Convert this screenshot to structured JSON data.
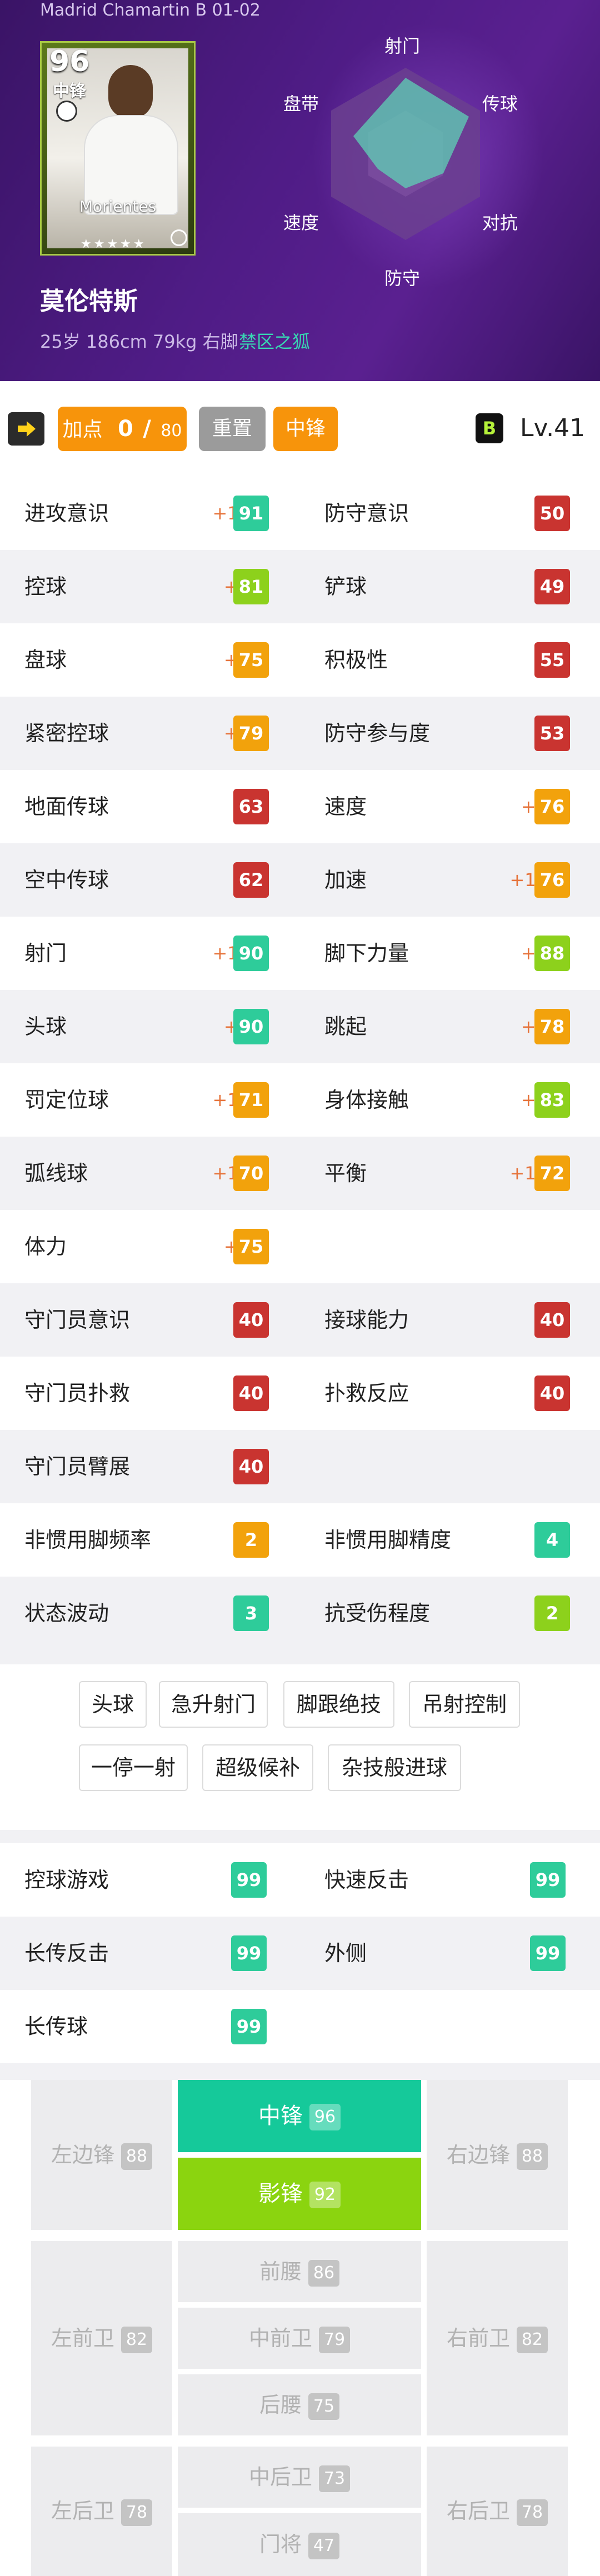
{
  "header": {
    "subtitle": "Madrid Chamartin B 01-02",
    "card": {
      "rating": "96",
      "position": "中锋",
      "name": "Morientes",
      "stars": "★★★★★"
    },
    "player_name": "莫伦特斯",
    "player_info": "25岁 186cm 79kg 右脚",
    "player_tag": "禁区之狐",
    "radar": {
      "labels": {
        "top": "射门",
        "top_left": "盘带",
        "top_right": "传球",
        "bottom_left": "速度",
        "bottom_right": "对抗",
        "bottom": "防守"
      },
      "colors": {
        "hex": "#6b3f8f",
        "hex_inner": "#7c4ea0",
        "fill": "#5fd1b5"
      }
    }
  },
  "toolbar": {
    "arrow_icon": "right-arrow-icon",
    "points_label": "加点",
    "points_value": "0",
    "points_sep": "/",
    "points_max": "80",
    "reset_label": "重置",
    "position_label": "中锋",
    "level_badge": "B",
    "level_text": "Lv.41"
  },
  "colors": {
    "green": "#2ecc9a",
    "lime": "#8dd11c",
    "orange": "#f2a20c",
    "red": "#c93430",
    "bonus": "#e6733a",
    "accent": "#f7940b"
  },
  "stats": [
    {
      "left": {
        "label": "进攻意识",
        "bonus": "+12",
        "value": "91",
        "tier": "green"
      },
      "right": {
        "label": "防守意识",
        "bonus": "",
        "value": "50",
        "tier": "red"
      }
    },
    {
      "left": {
        "label": "控球",
        "bonus": "+8",
        "value": "81",
        "tier": "lime"
      },
      "right": {
        "label": "铲球",
        "bonus": "",
        "value": "49",
        "tier": "red"
      }
    },
    {
      "left": {
        "label": "盘球",
        "bonus": "+8",
        "value": "75",
        "tier": "orange"
      },
      "right": {
        "label": "积极性",
        "bonus": "",
        "value": "55",
        "tier": "red"
      }
    },
    {
      "left": {
        "label": "紧密控球",
        "bonus": "+8",
        "value": "79",
        "tier": "orange"
      },
      "right": {
        "label": "防守参与度",
        "bonus": "",
        "value": "53",
        "tier": "red"
      }
    },
    {
      "left": {
        "label": "地面传球",
        "bonus": "",
        "value": "63",
        "tier": "red"
      },
      "right": {
        "label": "速度",
        "bonus": "+8",
        "value": "76",
        "tier": "orange"
      }
    },
    {
      "left": {
        "label": "空中传球",
        "bonus": "",
        "value": "62",
        "tier": "red"
      },
      "right": {
        "label": "加速",
        "bonus": "+12",
        "value": "76",
        "tier": "orange"
      }
    },
    {
      "left": {
        "label": "射门",
        "bonus": "+12",
        "value": "90",
        "tier": "green"
      },
      "right": {
        "label": "脚下力量",
        "bonus": "+8",
        "value": "88",
        "tier": "lime"
      }
    },
    {
      "left": {
        "label": "头球",
        "bonus": "+6",
        "value": "90",
        "tier": "green"
      },
      "right": {
        "label": "跳起",
        "bonus": "+6",
        "value": "78",
        "tier": "orange"
      }
    },
    {
      "left": {
        "label": "罚定位球",
        "bonus": "+12",
        "value": "71",
        "tier": "orange"
      },
      "right": {
        "label": "身体接触",
        "bonus": "+6",
        "value": "83",
        "tier": "lime"
      }
    },
    {
      "left": {
        "label": "弧线球",
        "bonus": "+12",
        "value": "70",
        "tier": "orange"
      },
      "right": {
        "label": "平衡",
        "bonus": "+12",
        "value": "72",
        "tier": "orange"
      }
    },
    {
      "left": {
        "label": "体力",
        "bonus": "+8",
        "value": "75",
        "tier": "orange"
      },
      "right": null
    },
    {
      "left": {
        "label": "守门员意识",
        "bonus": "",
        "value": "40",
        "tier": "red"
      },
      "right": {
        "label": "接球能力",
        "bonus": "",
        "value": "40",
        "tier": "red"
      }
    },
    {
      "left": {
        "label": "守门员扑救",
        "bonus": "",
        "value": "40",
        "tier": "red"
      },
      "right": {
        "label": "扑救反应",
        "bonus": "",
        "value": "40",
        "tier": "red"
      }
    },
    {
      "left": {
        "label": "守门员臂展",
        "bonus": "",
        "value": "40",
        "tier": "red"
      },
      "right": null
    },
    {
      "left": {
        "label": "非惯用脚频率",
        "bonus": "",
        "value": "2",
        "tier": "orange"
      },
      "right": {
        "label": "非惯用脚精度",
        "bonus": "",
        "value": "4",
        "tier": "green"
      }
    },
    {
      "left": {
        "label": "状态波动",
        "bonus": "",
        "value": "3",
        "tier": "green"
      },
      "right": {
        "label": "抗受伤程度",
        "bonus": "",
        "value": "2",
        "tier": "lime"
      }
    }
  ],
  "skills": [
    "头球",
    "急升射门",
    "脚跟绝技",
    "吊射控制",
    "一停一射",
    "超级候补",
    "杂技般进球"
  ],
  "playstyles": [
    {
      "left": {
        "label": "控球游戏",
        "value": "99"
      },
      "right": {
        "label": "快速反击",
        "value": "99"
      }
    },
    {
      "left": {
        "label": "长传反击",
        "value": "99"
      },
      "right": {
        "label": "外侧",
        "value": "99"
      }
    },
    {
      "left": {
        "label": "长传球",
        "value": "99"
      },
      "right": null
    }
  ],
  "positions": {
    "lwf": {
      "label": "左边锋",
      "value": "88"
    },
    "cf": {
      "label": "中锋",
      "value": "96"
    },
    "ss": {
      "label": "影锋",
      "value": "92"
    },
    "rwf": {
      "label": "右边锋",
      "value": "88"
    },
    "lmf": {
      "label": "左前卫",
      "value": "82"
    },
    "amf": {
      "label": "前腰",
      "value": "86"
    },
    "cmf": {
      "label": "中前卫",
      "value": "79"
    },
    "dmf": {
      "label": "后腰",
      "value": "75"
    },
    "rmf": {
      "label": "右前卫",
      "value": "82"
    },
    "lb": {
      "label": "左后卫",
      "value": "78"
    },
    "cb": {
      "label": "中后卫",
      "value": "73"
    },
    "gk": {
      "label": "门将",
      "value": "47"
    },
    "rb": {
      "label": "右后卫",
      "value": "78"
    },
    "colors": {
      "cf": "#15c99a",
      "ss": "#8bd40f"
    }
  }
}
